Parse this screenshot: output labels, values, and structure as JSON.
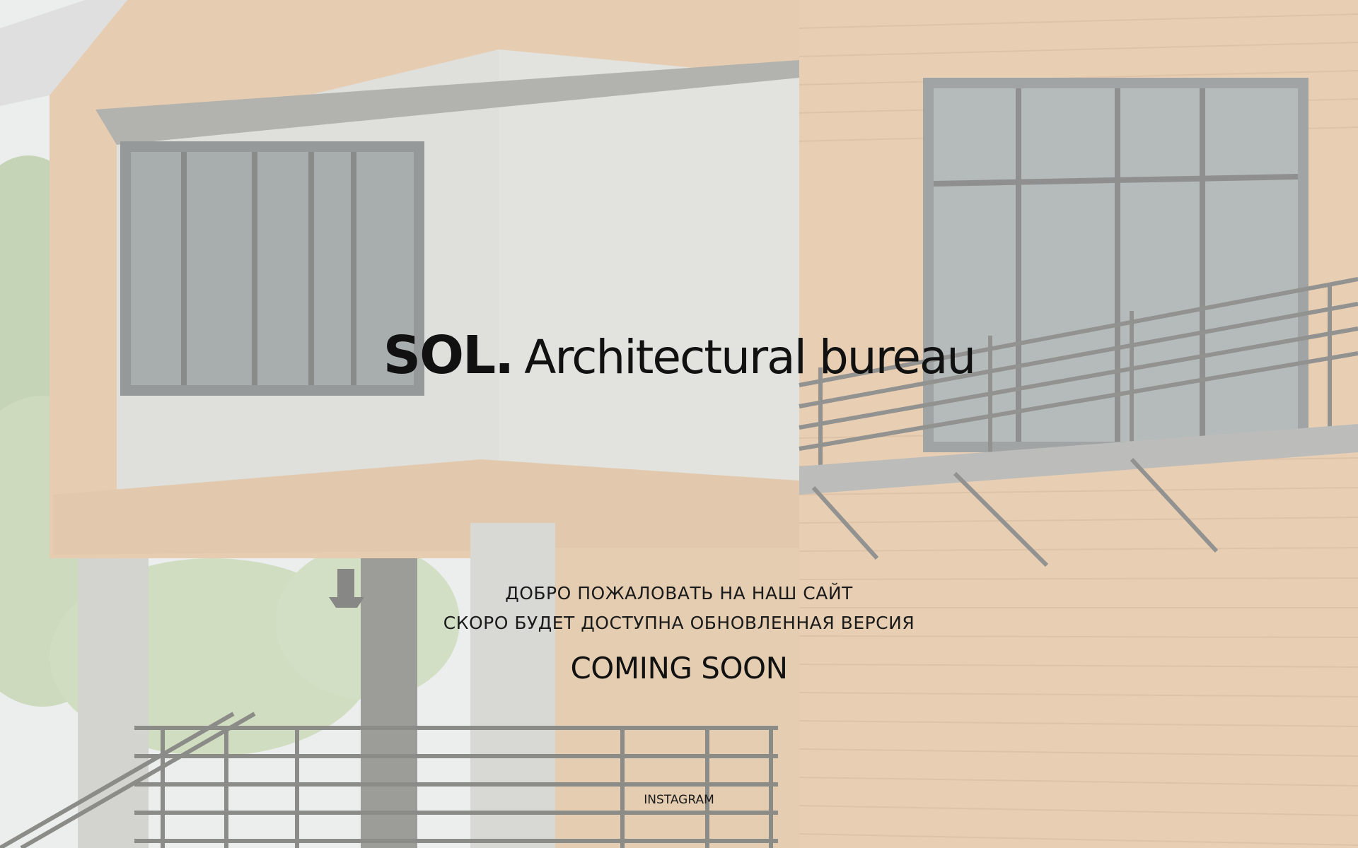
{
  "brand": {
    "mark": "SOL.",
    "tagline": "Architectural bureau"
  },
  "message": {
    "welcome": "ДОБРО ПОЖАЛОВАТЬ НА НАШ САЙТ",
    "update_notice": "СКОРО БУДЕТ ДОСТУПНА ОБНОВЛЕННАЯ ВЕРСИЯ",
    "coming_soon": "COMING SOON"
  },
  "links": {
    "instagram": "INSTAGRAM"
  },
  "background": {
    "image": "washed-out photo of modern house with wood siding and concrete volume",
    "colors": {
      "wood": "#d8b58e",
      "concrete": "#cfcfc9",
      "foliage": "#a9bf92",
      "railing": "#5a5a58"
    }
  }
}
